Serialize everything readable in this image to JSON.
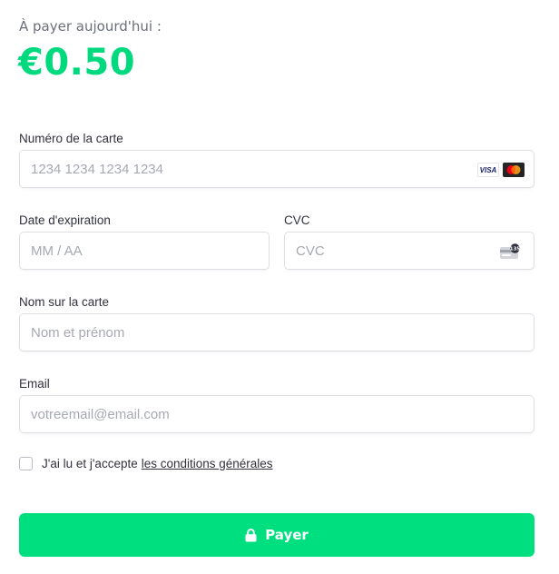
{
  "summary": {
    "amount_label": "À payer aujourd'hui :",
    "amount": "€0.50"
  },
  "form": {
    "card_number": {
      "label": "Numéro de la carte",
      "placeholder": "1234 1234 1234 1234",
      "value": "",
      "brands": [
        "visa-icon",
        "mastercard-icon"
      ],
      "visa_text": "VISA"
    },
    "expiry": {
      "label": "Date d'expiration",
      "placeholder": "MM / AA",
      "value": ""
    },
    "cvc": {
      "label": "CVC",
      "placeholder": "CVC",
      "value": "",
      "icon": "cvc-card-icon",
      "icon_text": "135"
    },
    "name": {
      "label": "Nom sur la carte",
      "placeholder": "Nom et prénom",
      "value": ""
    },
    "email": {
      "label": "Email",
      "placeholder": "votreemail@email.com",
      "value": ""
    }
  },
  "terms": {
    "text": "J'ai lu et j'accepte",
    "link": "les conditions générales",
    "checked": false
  },
  "pay_button": {
    "label": "Payer",
    "icon": "lock-icon"
  },
  "colors": {
    "accent": "#00df7f",
    "amount": "#00d97e",
    "border": "#dcdfe4",
    "placeholder": "#a6a9b1",
    "text": "#30313d"
  }
}
